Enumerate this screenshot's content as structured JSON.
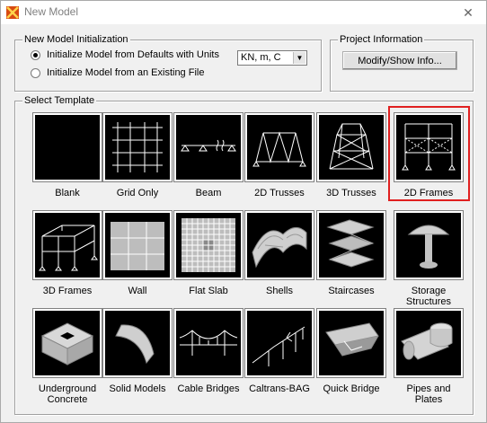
{
  "window": {
    "title": "New Model",
    "close_glyph": "✕",
    "highlight_color": "#e02020"
  },
  "init": {
    "legend": "New Model Initialization",
    "option_defaults": "Initialize Model from Defaults with Units",
    "option_existing": "Initialize Model  from an Existing File",
    "selected": "defaults",
    "units_value": "KN, m, C"
  },
  "project": {
    "legend": "Project Information",
    "button_label": "Modify/Show Info..."
  },
  "templates": {
    "legend": "Select Template",
    "items": [
      {
        "label": "Blank",
        "icon": "blank-icon"
      },
      {
        "label": "Grid Only",
        "icon": "grid-only-icon"
      },
      {
        "label": "Beam",
        "icon": "beam-icon"
      },
      {
        "label": "2D Trusses",
        "icon": "2d-trusses-icon"
      },
      {
        "label": "3D Trusses",
        "icon": "3d-trusses-icon"
      },
      {
        "label": "2D Frames",
        "icon": "2d-frames-icon",
        "highlighted": true
      },
      {
        "label": "3D Frames",
        "icon": "3d-frames-icon"
      },
      {
        "label": "Wall",
        "icon": "wall-icon"
      },
      {
        "label": "Flat Slab",
        "icon": "flat-slab-icon"
      },
      {
        "label": "Shells",
        "icon": "shells-icon"
      },
      {
        "label": "Staircases",
        "icon": "staircases-icon"
      },
      {
        "label": "Storage\nStructures",
        "icon": "storage-structures-icon"
      },
      {
        "label": "Underground\nConcrete",
        "icon": "underground-concrete-icon"
      },
      {
        "label": "Solid Models",
        "icon": "solid-models-icon"
      },
      {
        "label": "Cable Bridges",
        "icon": "cable-bridges-icon"
      },
      {
        "label": "Caltrans-BAG",
        "icon": "caltrans-bag-icon"
      },
      {
        "label": "Quick Bridge",
        "icon": "quick-bridge-icon"
      },
      {
        "label": "Pipes and\nPlates",
        "icon": "pipes-and-plates-icon"
      }
    ]
  }
}
